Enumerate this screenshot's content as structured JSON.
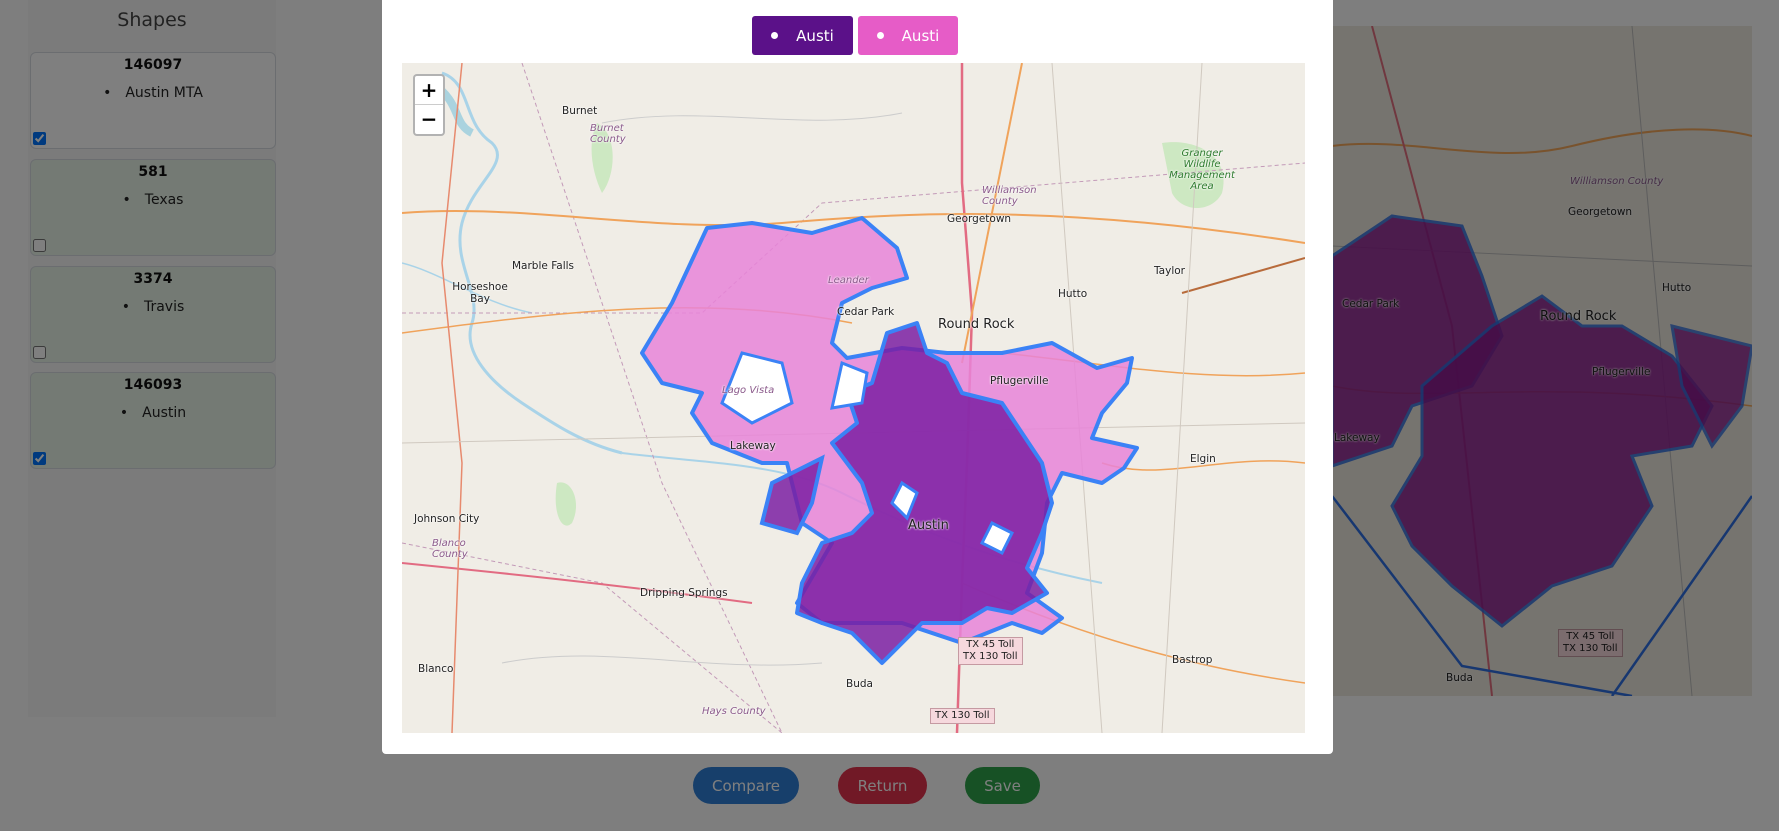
{
  "sidebar": {
    "title": "Shapes",
    "cards": [
      {
        "id": "146097",
        "name": "Austin MTA",
        "checked": true
      },
      {
        "id": "581",
        "name": "Texas",
        "checked": false
      },
      {
        "id": "3374",
        "name": "Travis",
        "checked": false
      },
      {
        "id": "146093",
        "name": "Austin",
        "checked": true
      }
    ]
  },
  "bottom_buttons": {
    "compare": "Compare",
    "return": "Return",
    "save": "Save"
  },
  "modal": {
    "legend": [
      {
        "label": "Austi",
        "color": "#5b1189"
      },
      {
        "label": "Austi",
        "color": "#e65cc7"
      }
    ],
    "zoom": {
      "in": "+",
      "out": "−"
    },
    "map_labels": {
      "burnet": "Burnet",
      "burnet_county": "Burnet County",
      "georgetown": "Georgetown",
      "williamson_county": "Williamson County",
      "granger": "Granger Wildlife Management Area",
      "marble_falls": "Marble Falls",
      "horseshoe_bay": "Horseshoe Bay",
      "taylor": "Taylor",
      "cedar_park": "Cedar Park",
      "hutto": "Hutto",
      "round_rock": "Round Rock",
      "pflugerville": "Pflugerville",
      "lakeway": "Lakeway",
      "elgin": "Elgin",
      "austin": "Austin",
      "johnson_city": "Johnson City",
      "blanco_county": "Blanco County",
      "dripping_springs": "Dripping Springs",
      "blanco": "Blanco",
      "buda": "Buda",
      "hays_county": "Hays County",
      "bastrop": "Bastrop",
      "leander": "Leander",
      "lago_vista": "Lago Vista",
      "shield_1": "TX 45 Toll",
      "shield_2": "TX 130 Toll",
      "shield_3": "TX 130 Toll"
    }
  },
  "bg_map_labels": {
    "williamson_county": "Williamson County",
    "georgetown": "Georgetown",
    "cedar_park": "Cedar Park",
    "round_rock": "Round Rock",
    "hutto": "Hutto",
    "pflugerville": "Pflugerville",
    "lakeway": "Lakeway",
    "buda": "Buda",
    "shield_1": "TX 45 Toll",
    "shield_2": "TX 130 Toll"
  },
  "colors": {
    "austin_city": "#7b1fa2",
    "austin_mta": "#e884d8",
    "boundary": "#3b82f6",
    "compare": "#2f7fd6",
    "return": "#e2334d",
    "save": "#2ea34a"
  }
}
